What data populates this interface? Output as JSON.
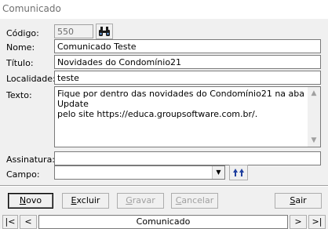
{
  "window": {
    "title": "Comunicado"
  },
  "form": {
    "codigo": {
      "label": "Código:",
      "value": "550"
    },
    "nome": {
      "label": "Nome:",
      "value": "Comunicado Teste"
    },
    "titulo": {
      "label": "Título:",
      "value": "Novidades do Condomínio21"
    },
    "localidade": {
      "label": "Localidade:",
      "value": "teste"
    },
    "texto": {
      "label": "Texto:",
      "value": "Fique por dentro das novidades do Condomínio21 na aba Update\npelo site https://educa.groupsoftware.com.br/."
    },
    "assinatura": {
      "label": "Assinatura:",
      "value": ""
    },
    "campo": {
      "label": "Campo:",
      "value": ""
    }
  },
  "buttons": {
    "novo": {
      "pre": "",
      "key": "N",
      "post": "ovo"
    },
    "excluir": {
      "pre": "",
      "key": "E",
      "post": "xcluir"
    },
    "gravar": {
      "pre": "",
      "key": "G",
      "post": "ravar"
    },
    "cancelar": {
      "pre": "",
      "key": "C",
      "post": "ancelar"
    },
    "sair": {
      "pre": "",
      "key": "S",
      "post": "air"
    }
  },
  "nav": {
    "first": "|<",
    "prev": "<",
    "label": "Comunicado",
    "next": ">",
    "last": ">|"
  },
  "icons": {
    "search": "binoculars-icon",
    "insert_field": "double-up-arrow-icon",
    "combo_arrow": "chevron-down-icon"
  }
}
